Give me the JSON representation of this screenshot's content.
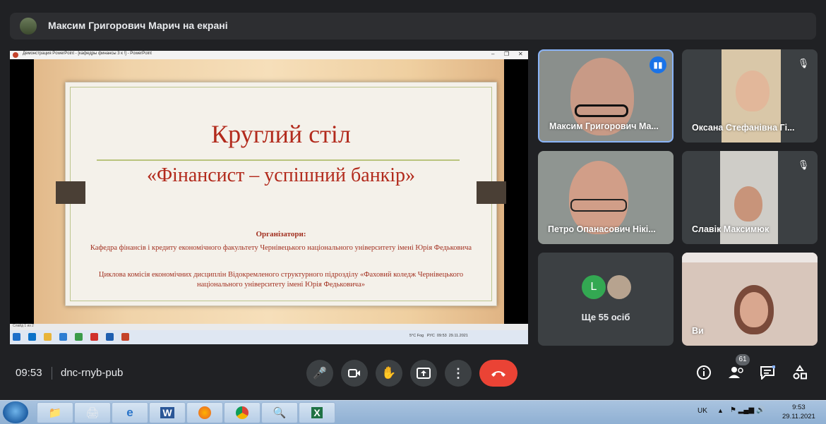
{
  "banner": {
    "text": "Максим Григорович Марич на екрані"
  },
  "screen": {
    "window_title": "Демонстрация PowerPoint - [кафедры финансы 3 к !] - PowerPoint",
    "slide": {
      "title": "Круглий стіл",
      "subtitle": "«Фінансист – успішний банкір»",
      "organizers_label": "Організатори:",
      "org1": "Кафедра фінансів і кредиту економічного факультету Чернівецького національного університету імені Юрія Федьковича",
      "org2": "Циклова комісія економічних дисциплін Відокремленого структурного підрозділу «Фаховий коледж Чернівецького національного університету імені Юрія Федьковича»"
    },
    "status_bar": "Слайд 1 из 2",
    "tray_weather": "5°C Fog",
    "tray_lang": "РУС",
    "tray_time": "09:53",
    "tray_date": "29.11.2021"
  },
  "participants": [
    {
      "name": "Максим Григорович Ма...",
      "speaking": true
    },
    {
      "name": "Оксана Стефанівна Гі...",
      "muted": true
    },
    {
      "name": "Петро Опанасович Нікі..."
    },
    {
      "name": "Славік Максимюк",
      "muted": true
    },
    {
      "name": "Ще 55 осіб",
      "avatar_letter": "L"
    },
    {
      "name": "Ви"
    }
  ],
  "bottom": {
    "time": "09:53",
    "meeting_code": "dnc-rnyb-pub",
    "participant_count": "61"
  },
  "windows_taskbar": {
    "lang": "UK",
    "time": "9:53",
    "date": "29.11.2021"
  },
  "colors": {
    "end_call": "#ea4335",
    "speaking": "#1a73e8",
    "tile_bg": "#3c4043"
  }
}
